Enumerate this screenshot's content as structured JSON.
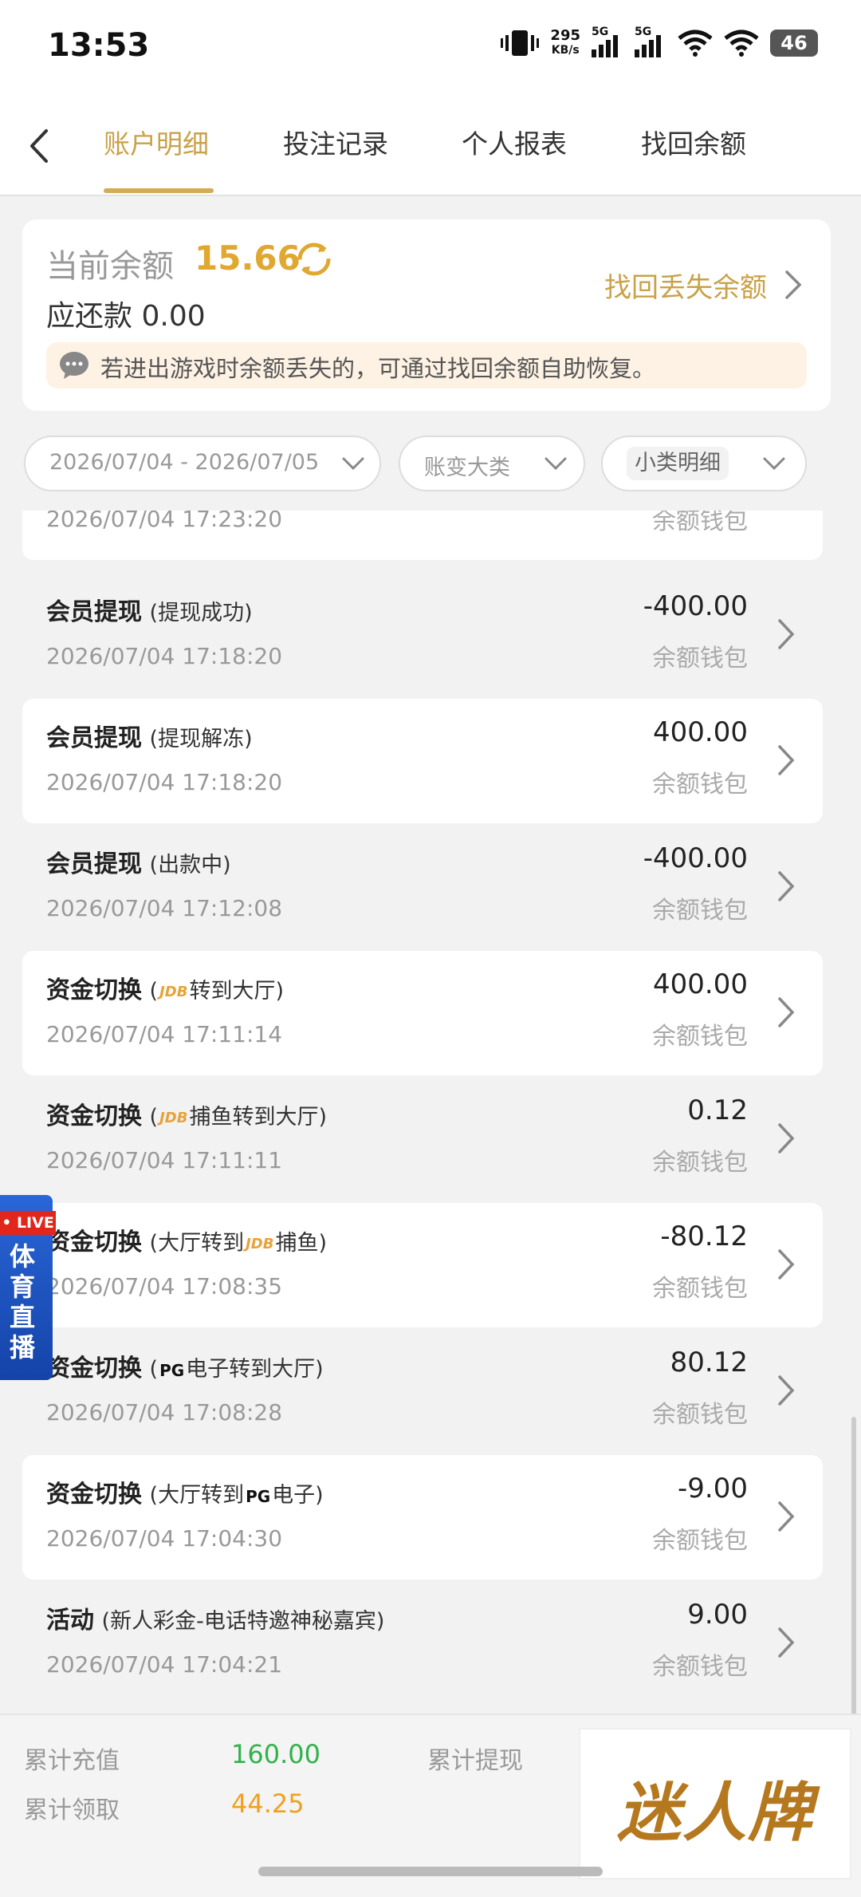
{
  "status_bar": {
    "time": "13:53",
    "net_speed": "295",
    "net_unit": "KB/s",
    "sig1": "5G",
    "sig2": "5G",
    "battery": "46"
  },
  "tabs": [
    "账户明细",
    "投注记录",
    "个人报表",
    "找回余额"
  ],
  "balance": {
    "label": "当前余额",
    "value": "15.66",
    "owe_label": "应还款",
    "owe_value": "0.00",
    "recover_link": "找回丢失余额",
    "tip": "若进出游戏时余额丢失的，可通过找回余额自助恢复。"
  },
  "filters": {
    "date_range": "2026/07/04 - 2026/07/05",
    "category": "账变大类",
    "subcategory": "小类明细"
  },
  "partial_row": {
    "time": "2026/07/04 17:23:20",
    "wallet": "余额钱包"
  },
  "transactions": [
    {
      "title": "会员提现",
      "pre": "(提现成功)",
      "logo": "",
      "post": "",
      "time": "2026/07/04 17:18:20",
      "amount": "-400.00",
      "wallet": "余额钱包"
    },
    {
      "title": "会员提现",
      "pre": "(提现解冻)",
      "logo": "",
      "post": "",
      "time": "2026/07/04 17:18:20",
      "amount": "400.00",
      "wallet": "余额钱包"
    },
    {
      "title": "会员提现",
      "pre": "(出款中)",
      "logo": "",
      "post": "",
      "time": "2026/07/04 17:12:08",
      "amount": "-400.00",
      "wallet": "余额钱包"
    },
    {
      "title": "资金切换",
      "pre": "(",
      "logo": "JDB",
      "post": "转到大厅)",
      "time": "2026/07/04 17:11:14",
      "amount": "400.00",
      "wallet": "余额钱包"
    },
    {
      "title": "资金切换",
      "pre": "(",
      "logo": "JDB",
      "post": "捕鱼转到大厅)",
      "time": "2026/07/04 17:11:11",
      "amount": "0.12",
      "wallet": "余额钱包"
    },
    {
      "title": "资金切换",
      "pre": "(大厅转到",
      "logo": "JDB",
      "post": "捕鱼)",
      "time": "2026/07/04 17:08:35",
      "amount": "-80.12",
      "wallet": "余额钱包"
    },
    {
      "title": "资金切换",
      "pre": "(",
      "logo": "PG",
      "post": "电子转到大厅)",
      "time": "2026/07/04 17:08:28",
      "amount": "80.12",
      "wallet": "余额钱包"
    },
    {
      "title": "资金切换",
      "pre": "(大厅转到",
      "logo": "PG",
      "post": "电子)",
      "time": "2026/07/04 17:04:30",
      "amount": "-9.00",
      "wallet": "余额钱包"
    },
    {
      "title": "活动",
      "pre": "(新人彩金-电话特邀神秘嘉宾)",
      "logo": "",
      "post": "",
      "time": "2026/07/04 17:04:21",
      "amount": "9.00",
      "wallet": "余额钱包"
    }
  ],
  "live_badge": {
    "tag": "• LIVE",
    "text": "体育直播"
  },
  "footer": {
    "deposit_label": "累计充值",
    "deposit_value": "160.00",
    "withdraw_label": "累计提现",
    "claim_label": "累计领取",
    "claim_value": "44.25",
    "brand": "迷人牌"
  },
  "colors": {
    "accent": "#c9a148",
    "balance": "#e0a830",
    "green": "#2fb34a",
    "orange": "#f0a020"
  }
}
